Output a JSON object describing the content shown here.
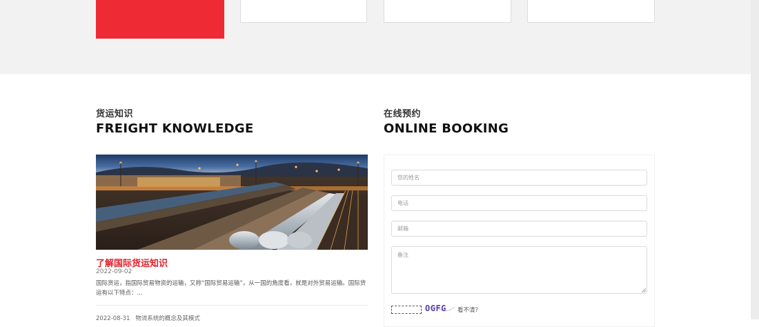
{
  "freight": {
    "sub": "货运知识",
    "title": "FREIGHT KNOWLEDGE",
    "featured": {
      "title": "了解国际货运知识",
      "date": "2022-09-02",
      "summary": "国际货运，指国际贸易物资的运输，又称“国际贸易运输”，从一国的角度看，就是对外贸易运输。国际货运有以下特点：..."
    },
    "list": [
      {
        "date": "2022-08-31",
        "title": "物流系统的概念及其模式"
      }
    ]
  },
  "booking": {
    "sub": "在线预约",
    "title": "ONLINE BOOKING",
    "name_placeholder": "您的姓名",
    "phone_placeholder": "电话",
    "email_placeholder": "邮箱",
    "remark_placeholder": "备注",
    "captcha_code": "OGFG",
    "captcha_refresh": "看不清？"
  },
  "colors": {
    "accent": "#ee2a34",
    "background_band": "#f2f2f2"
  }
}
